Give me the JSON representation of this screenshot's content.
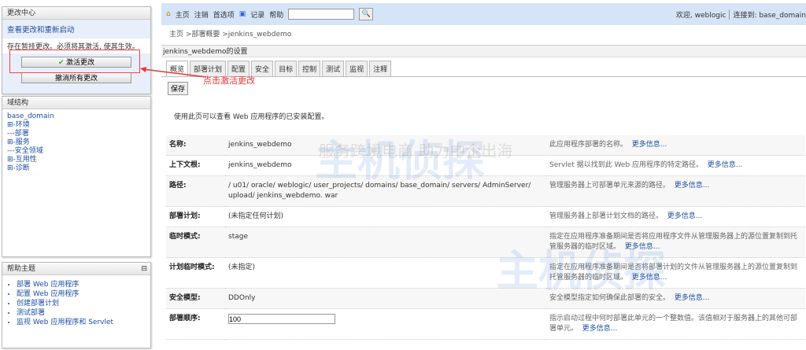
{
  "change_center": {
    "title": "更改中心",
    "view_link": "查看更改和重新启动",
    "message": "存在暂挂更改。必须将其激活, 使其生效。",
    "activate": "激活更改",
    "undo": "撤消所有更改"
  },
  "domain_structure": {
    "title": "域结构",
    "root": "base_domain",
    "items": [
      "⊞-环境",
      "---部署",
      "⊞-服务",
      "---安全领域",
      "⊞-互用性",
      "⊞-诊断"
    ]
  },
  "help": {
    "title": "帮助主题",
    "collapse": "⊟",
    "items": [
      "部署 Web 应用程序",
      "配置 Web 应用程序",
      "创建部署计划",
      "测试部署",
      "监视 Web 应用程序和 Servlet"
    ]
  },
  "toolbar": {
    "home": "主页",
    "logout": "注销",
    "prefs": "首选项",
    "record": "记录",
    "help": "帮助",
    "search_value": "",
    "welcome": "欢迎, weblogic",
    "connected": "连接到: base_domain"
  },
  "breadcrumb": "主页 >部署概要 >jenkins_webdemo",
  "title": "jenkins_webdemo的设置",
  "tabs": [
    "概览",
    "部署计划",
    "配置",
    "安全",
    "目标",
    "控制",
    "测试",
    "监视",
    "注释"
  ],
  "save": "保存",
  "description": "使用此页可以查看 Web 应用程序的已安装配置。",
  "more": "更多信息...",
  "rows": [
    {
      "label": "名称:",
      "value": "jenkins_webdemo",
      "desc": "此应用程序部署的名称。"
    },
    {
      "label": "上下文根:",
      "value": "jenkins_webdemo",
      "desc": "Servlet 据以找到此 Web 应用程序的特定路径。"
    },
    {
      "label": "路径:",
      "value": "/ u01/ oracle/ weblogic/ user_projects/ domains/ base_domain/ servers/ AdminServer/ upload/ jenkins_webdemo. war",
      "desc": "管理服务器上可部署单元来源的路径。"
    },
    {
      "label": "部署计划:",
      "value": "(未指定任何计划)",
      "desc": "管理服务器上部署计划文档的路径。"
    },
    {
      "label": "临时模式:",
      "value": "stage",
      "desc": "指定在应用程序准备期间是否将应用程序文件从管理服务器上的源位置复制到托管服务器的临时区域。"
    },
    {
      "label": "计划临时模式:",
      "value": "(未指定)",
      "desc": "指定在应用程序准备期间是否将部署计划的文件从管理服务器上的源位置复制到托管服务器的临时区域。"
    },
    {
      "label": "安全模型:",
      "value": "DDOnly",
      "desc": "安全模型指定如何确保此部署的安全。"
    },
    {
      "label": "部署顺序:",
      "value": "100",
      "desc": "指示启动过程中何时部署此单元的一个整数值。该值相对于服务器上的其他可部署单元。"
    }
  ],
  "annotation": "点击激活更改",
  "watermark": {
    "logo": "主机侦探",
    "slogan": "服务跨境电商 助力中企出海"
  }
}
